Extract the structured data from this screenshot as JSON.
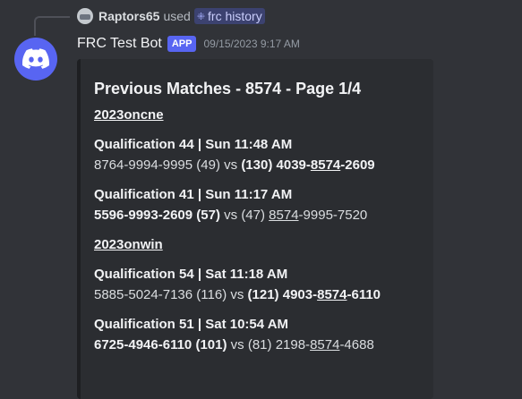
{
  "reply": {
    "user": "Raptors65",
    "used_text": "used",
    "command": "frc history"
  },
  "message": {
    "bot_name": "FRC Test Bot",
    "tag": "APP",
    "timestamp": "09/15/2023 9:17 AM"
  },
  "embed": {
    "title": "Previous Matches - 8574 - Page 1/4",
    "events": [
      {
        "name": "2023oncne",
        "matches": [
          {
            "title": "Qualification 44 | Sun 11:48 AM",
            "red": "8764-9994-9995",
            "red_score": "(49)",
            "vs": "vs",
            "blue_score": "(130)",
            "blue_pre": "4039-",
            "team": "8574",
            "blue_post": "-2609"
          },
          {
            "title": "Qualification 41 | Sun 11:17 AM",
            "red": "5596-9993-2609",
            "red_score": "(57)",
            "vs": "vs",
            "blue_score": "(47)",
            "blue_team": "8574",
            "blue_post": "-9995-7520"
          }
        ]
      },
      {
        "name": "2023onwin",
        "matches": [
          {
            "title": "Qualification 54 | Sat 11:18 AM",
            "red": "5885-5024-7136",
            "red_score": "(116)",
            "vs": "vs",
            "blue_score": "(121)",
            "blue_pre": "4903-",
            "team": "8574",
            "blue_post": "-6110"
          },
          {
            "title": "Qualification 51 | Sat 10:54 AM",
            "red": "6725-4946-6110",
            "red_score": "(101)",
            "vs": "vs",
            "blue_score": "(81)",
            "blue_pre": "2198-",
            "team": "8574",
            "blue_post": "-4688"
          }
        ]
      }
    ]
  },
  "colors": {
    "background": "#313338",
    "embed_background": "#2b2d31",
    "brand": "#5865f2",
    "command_pill": "#3c4270"
  },
  "icons": {
    "avatar": "discord-logo-icon",
    "command": "slash-command-icon"
  }
}
